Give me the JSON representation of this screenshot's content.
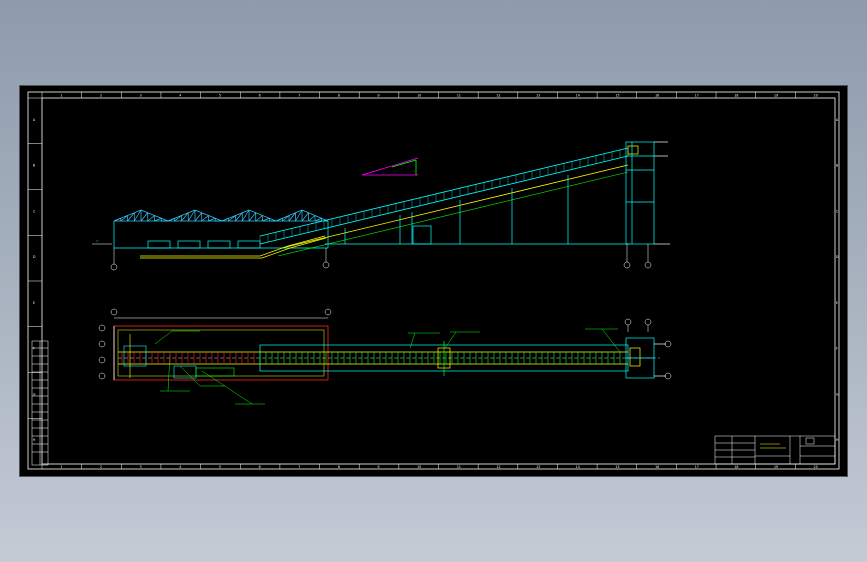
{
  "drawing": {
    "background": "#000000",
    "colors": {
      "frame": "#ffffff",
      "structure": "#00ffff",
      "truss": "#33ccff",
      "conveyor": "#00ff33",
      "belt": "#ffff00",
      "idler": "#ff2222",
      "annotation": "#00ff00",
      "gradient_mark": "#ff00ff"
    },
    "column_markers": [
      "1",
      "2",
      "3",
      "4",
      "5",
      "6",
      "7",
      "8",
      "9",
      "10",
      "11",
      "12",
      "13",
      "14",
      "15",
      "16",
      "17",
      "18",
      "19",
      "20"
    ],
    "row_markers": [
      "A",
      "B",
      "C",
      "D",
      "E",
      "F",
      "G",
      "H"
    ],
    "title_block": {
      "rows": [
        "",
        "",
        "",
        ""
      ],
      "note": ""
    }
  }
}
